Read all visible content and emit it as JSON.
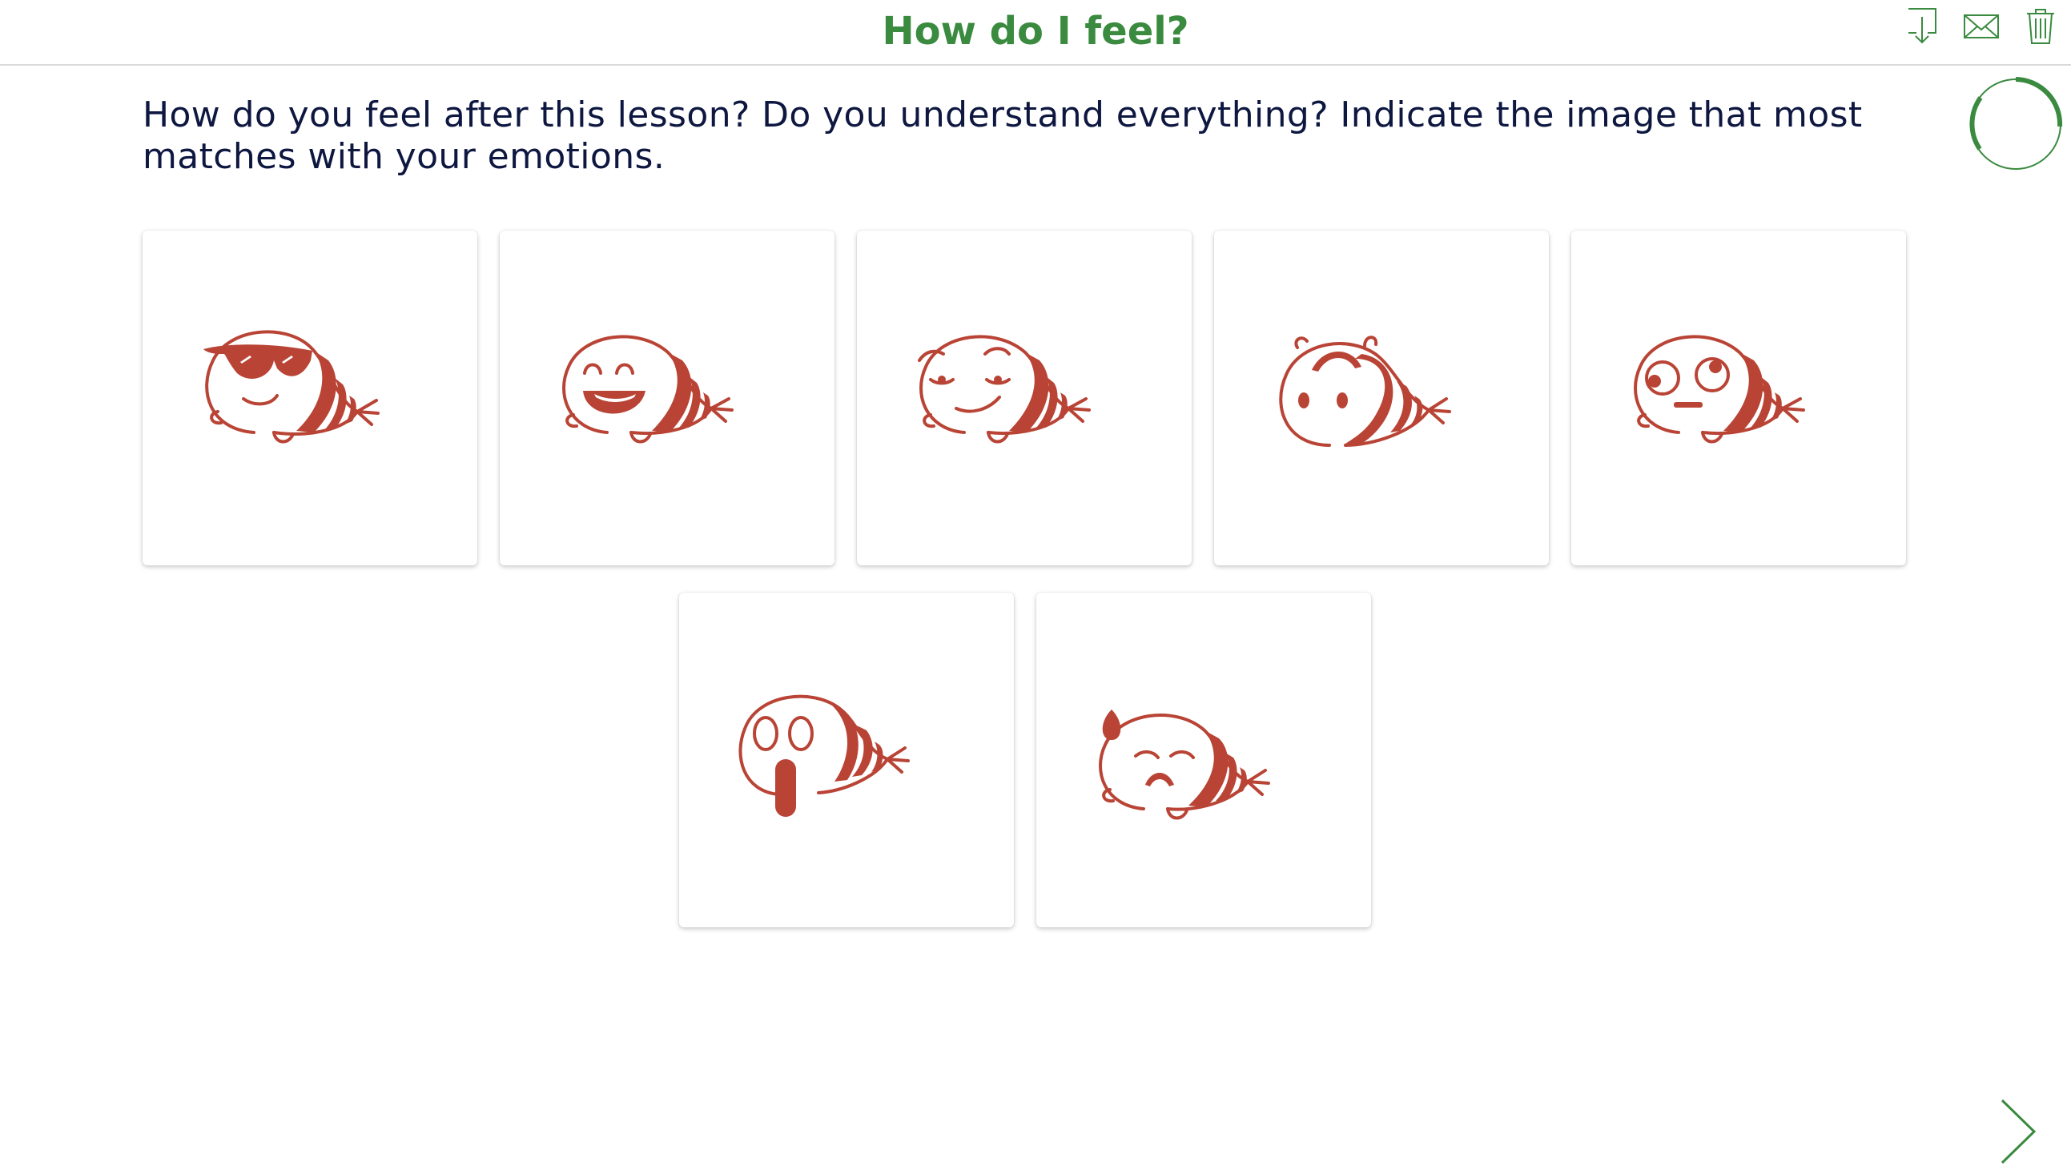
{
  "header": {
    "title": "How do I feel?"
  },
  "toolbar": {
    "icons": [
      "download-icon",
      "mail-icon",
      "trash-icon"
    ]
  },
  "instruction": "How do you feel after this lesson? Do you understand everything? Indicate the image that most matches with your emotions.",
  "options": [
    {
      "emotion": "cool"
    },
    {
      "emotion": "happy"
    },
    {
      "emotion": "smirk"
    },
    {
      "emotion": "surprised"
    },
    {
      "emotion": "confused"
    },
    {
      "emotion": "shocked"
    },
    {
      "emotion": "sad"
    }
  ],
  "colors": {
    "accent": "#3a8a3f",
    "illustration": "#b94435",
    "text": "#0d1740"
  }
}
